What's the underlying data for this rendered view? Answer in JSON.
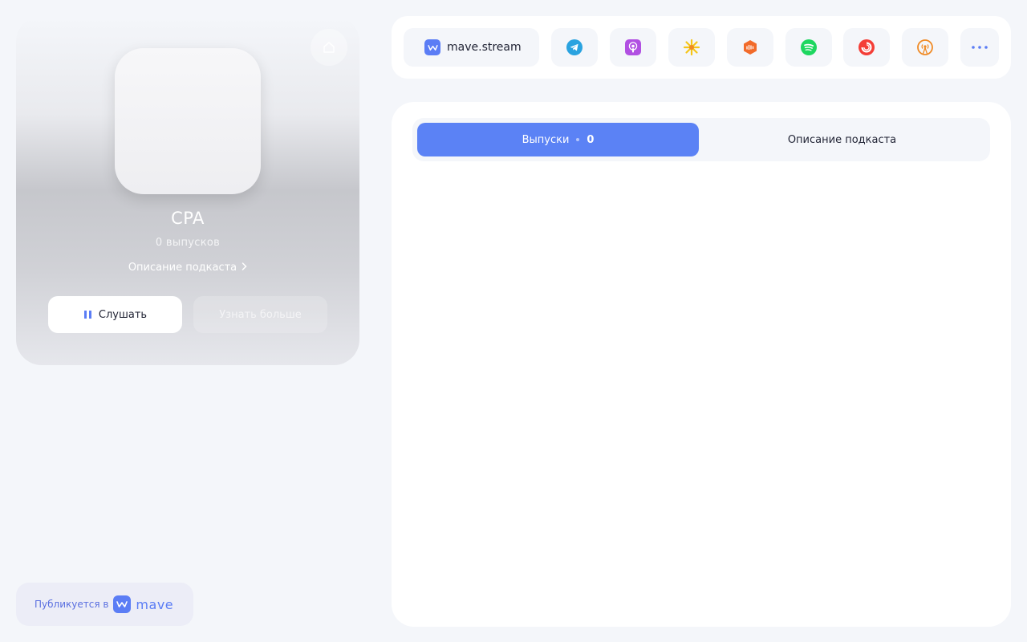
{
  "podcast": {
    "title": "CPA",
    "episode_count": "0 выпусков",
    "description_link": "Описание подкаста",
    "listen_label": "Слушать",
    "learn_more_label": "Узнать больше"
  },
  "published": {
    "label": "Публикуется в",
    "brand": "mave"
  },
  "platforms": {
    "main_label": "mave.stream",
    "items": [
      {
        "name": "telegram-icon",
        "color": "#2aa3e0"
      },
      {
        "name": "apple-podcasts-icon",
        "color": "#b150e2"
      },
      {
        "name": "yandex-music-icon",
        "color": "#f5c518"
      },
      {
        "name": "soundstream-icon",
        "color": "#f26b2a"
      },
      {
        "name": "spotify-icon",
        "color": "#1ed760"
      },
      {
        "name": "pocket-casts-icon",
        "color": "#f43e37"
      },
      {
        "name": "overcast-icon",
        "color": "#f08a24"
      },
      {
        "name": "more-icon",
        "color": "#5b7df5"
      }
    ]
  },
  "tabs": {
    "episodes_label": "Выпуски",
    "episodes_count": "0",
    "description_label": "Описание подкаста"
  },
  "colors": {
    "accent": "#5b82f5",
    "background": "#f4f6fa"
  }
}
